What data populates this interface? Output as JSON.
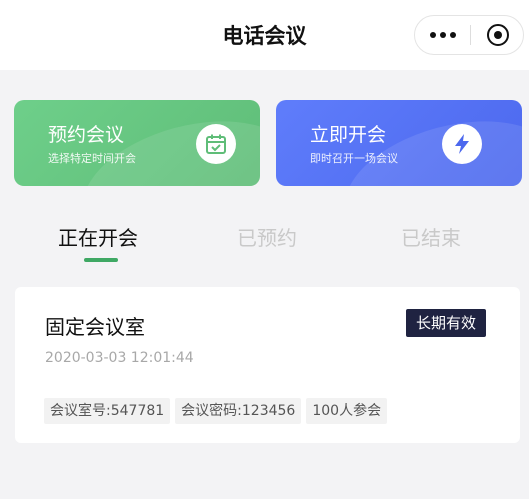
{
  "nav": {
    "title": "电话会议",
    "more_icon": "more-dots-icon",
    "close_icon": "target-icon"
  },
  "actions": {
    "schedule": {
      "title": "预约会议",
      "subtitle": "选择特定时间开会",
      "icon": "calendar-check-icon",
      "color": "#64c47d"
    },
    "instant": {
      "title": "立即开会",
      "subtitle": "即时召开一场会议",
      "icon": "lightning-icon",
      "color": "#5573f4"
    }
  },
  "tabs": [
    {
      "label": "正在开会",
      "active": true
    },
    {
      "label": "已预约",
      "active": false
    },
    {
      "label": "已结束",
      "active": false
    }
  ],
  "meeting": {
    "title": "固定会议室",
    "badge": "长期有效",
    "time": "2020-03-03 12:01:44",
    "tags": [
      "会议室号:547781",
      "会议密码:123456",
      "100人参会"
    ]
  },
  "colors": {
    "accent_green": "#3fa864",
    "badge_bg": "#1f2341"
  }
}
